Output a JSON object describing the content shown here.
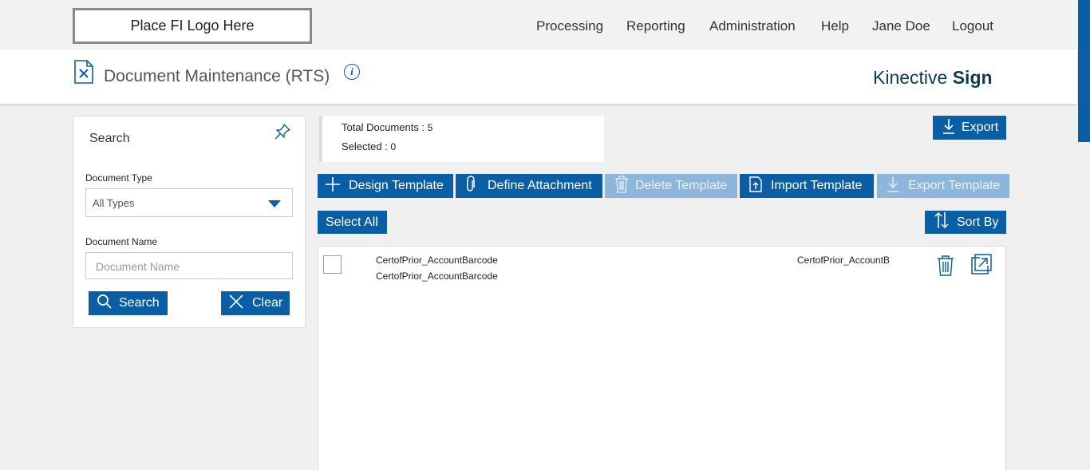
{
  "header": {
    "logo_text": "Place FI Logo Here",
    "nav": [
      "Processing",
      "Reporting",
      "Administration",
      "Help",
      "Jane Doe",
      "Logout"
    ]
  },
  "titlebar": {
    "title": "Document Maintenance (RTS)",
    "info_icon": "i",
    "brand_light": "Kinective ",
    "brand_bold": "Sign"
  },
  "search": {
    "title": "Search",
    "doc_type_label": "Document Type",
    "doc_type_value": "All Types",
    "doc_name_label": "Document Name",
    "doc_name_placeholder": "Document Name",
    "search_button": "Search",
    "clear_button": "Clear"
  },
  "summary": {
    "total_label": "Total Documents : ",
    "total_value": "5",
    "selected_label": "Selected : ",
    "selected_value": "0"
  },
  "toolbar": {
    "export": "Export",
    "design_template": "Design Template",
    "define_attachment": "Define Attachment",
    "delete_template": "Delete Template",
    "import_template": "Import Template",
    "export_template": "Export Template",
    "select_all": "Select All",
    "sort_by": "Sort By"
  },
  "documents": [
    {
      "name": "CertofPrior_AccountBarcode",
      "description": "CertofPrior_AccountBarcode",
      "code": "CertofPrior_AccountB",
      "checked": false
    }
  ],
  "colors": {
    "accent": "#0a5ea6",
    "disabled": "#8db7da",
    "brand": "#0d3b4f"
  },
  "icons": [
    "document-icon",
    "info-icon",
    "pin-icon",
    "search-icon",
    "close-icon",
    "download-icon",
    "plus-icon",
    "paperclip-icon",
    "trash-icon",
    "upload-file-icon",
    "sort-icon",
    "open-external-icon"
  ]
}
